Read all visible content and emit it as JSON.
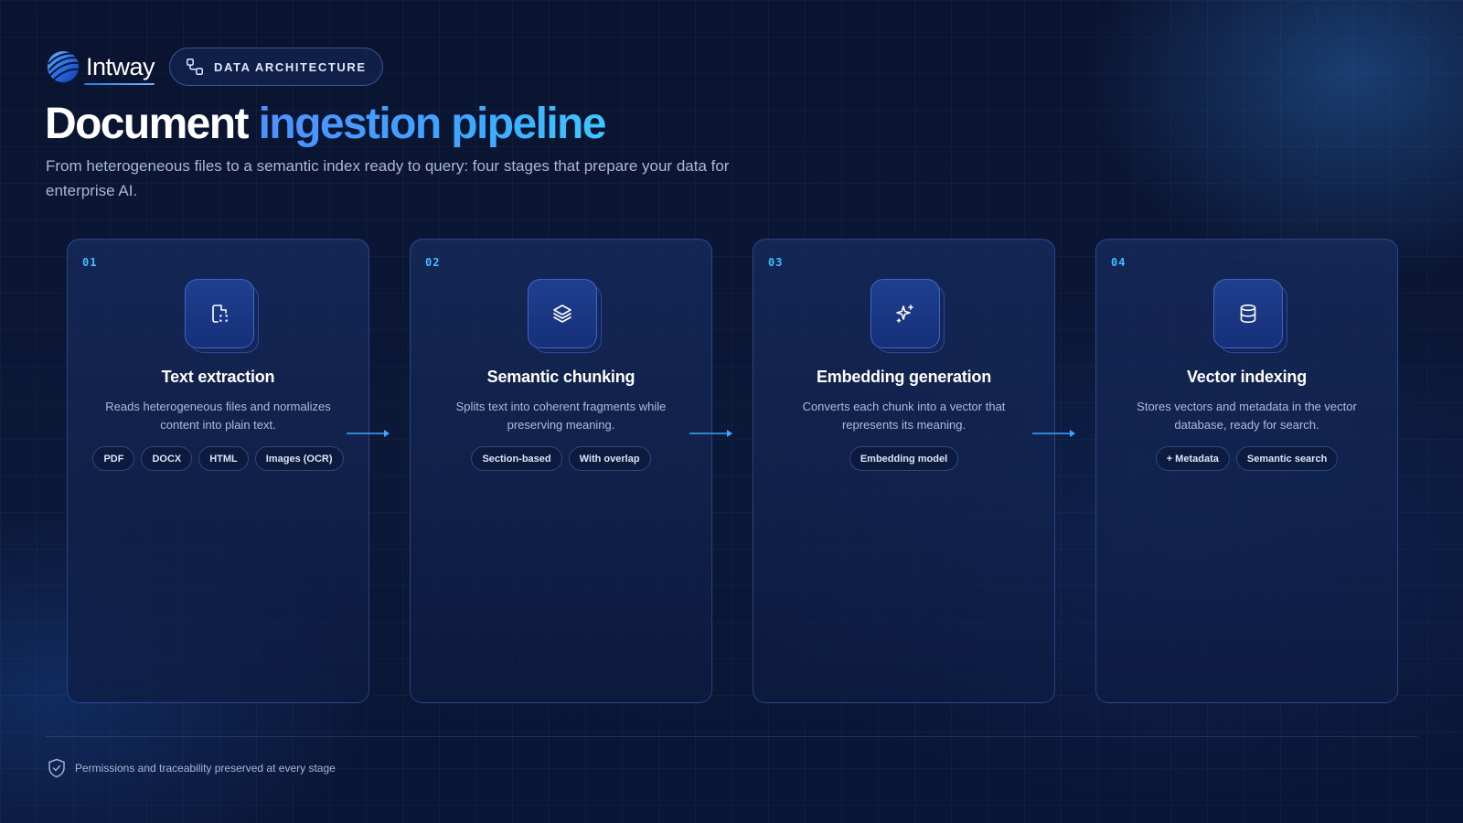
{
  "brand": {
    "name": "Intway"
  },
  "badge": {
    "label": "DATA ARCHITECTURE"
  },
  "title": {
    "lead": "Document",
    "accent": "ingestion pipeline"
  },
  "subtitle": "From heterogeneous files to a semantic index ready to query: four stages that prepare your data for enterprise AI.",
  "stages": [
    {
      "number": "01",
      "icon": "file-scan-icon",
      "title": "Text extraction",
      "description": "Reads heterogeneous files and normalizes content into plain text.",
      "tags": [
        "PDF",
        "DOCX",
        "HTML",
        "Images (OCR)"
      ]
    },
    {
      "number": "02",
      "icon": "layers-icon",
      "title": "Semantic chunking",
      "description": "Splits text into coherent fragments while preserving meaning.",
      "tags": [
        "Section-based",
        "With overlap"
      ]
    },
    {
      "number": "03",
      "icon": "sparkles-icon",
      "title": "Embedding generation",
      "description": "Converts each chunk into a vector that represents its meaning.",
      "tags": [
        "Embedding model"
      ]
    },
    {
      "number": "04",
      "icon": "database-icon",
      "title": "Vector indexing",
      "description": "Stores vectors and metadata in the vector database, ready for search.",
      "tags": [
        "+ Metadata",
        "Semantic search"
      ]
    }
  ],
  "footer": {
    "icon": "shield-check-icon",
    "text": "Permissions and traceability preserved at every stage"
  },
  "colors": {
    "accent": "#3ea6ff",
    "number": "#3ec0ff",
    "background": "#0b1837"
  }
}
